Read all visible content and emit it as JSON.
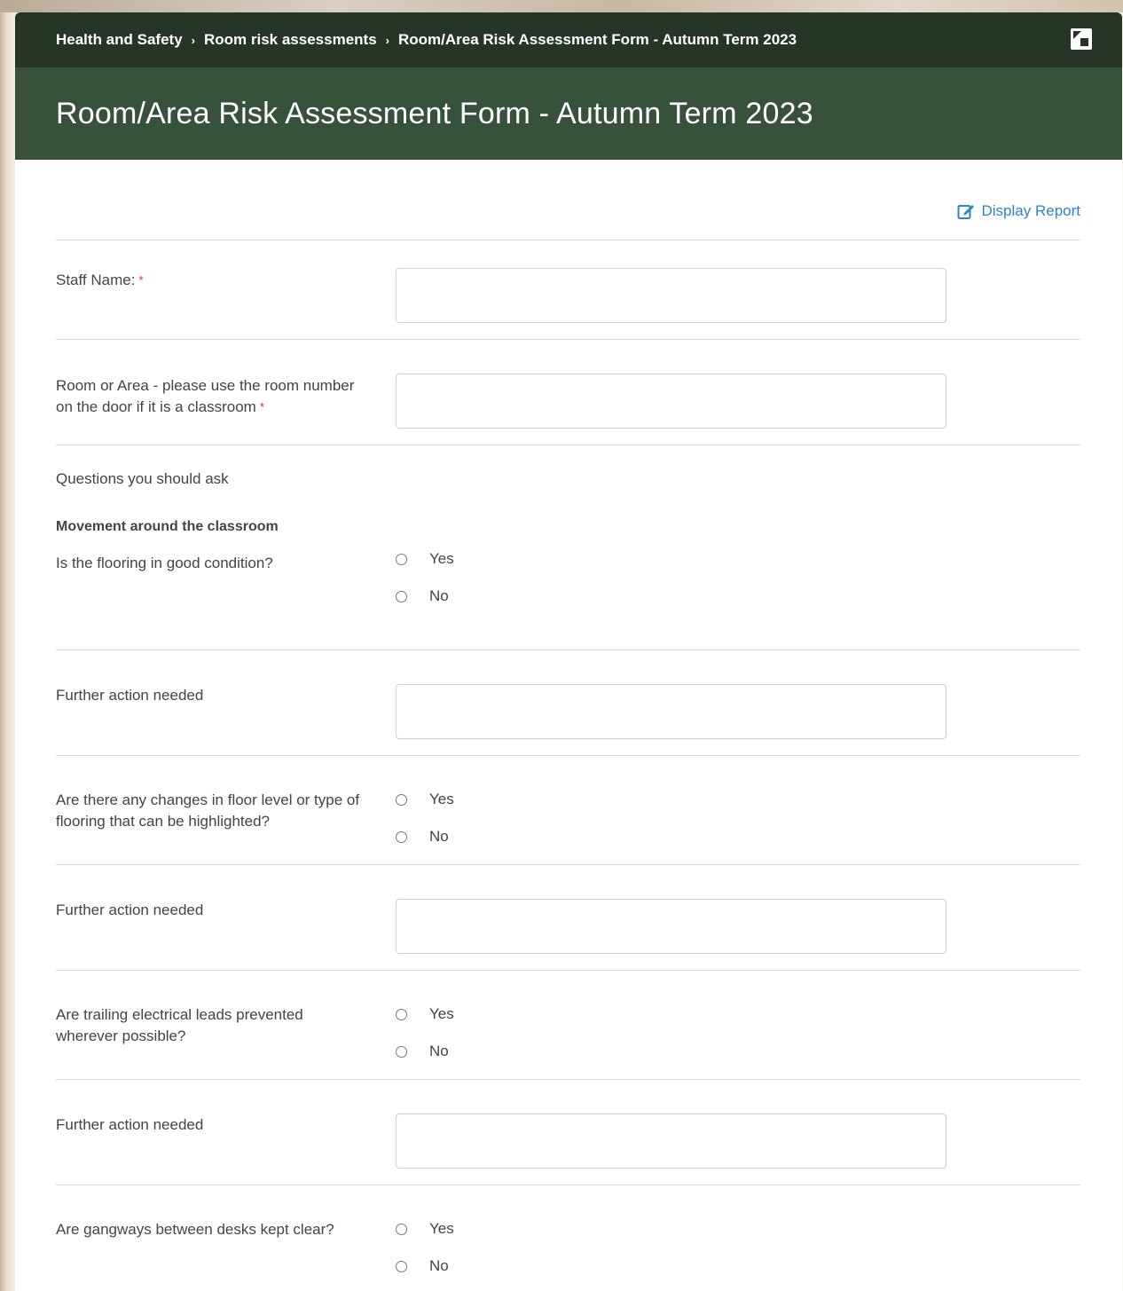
{
  "breadcrumb": {
    "items": [
      "Health and Safety",
      "Room risk assessments",
      "Room/Area Risk Assessment Form - Autumn Term 2023"
    ],
    "separator": "›"
  },
  "page": {
    "title": "Room/Area Risk Assessment Form - Autumn Term 2023",
    "display_report": "Display Report"
  },
  "colors": {
    "header_dark": "#263527",
    "header_green": "#37513a",
    "link": "#2a86c9",
    "required": "#d32f2f"
  },
  "form": {
    "staff_name": {
      "label": "Staff Name:",
      "required_mark": "*",
      "value": ""
    },
    "room": {
      "label": "Room or Area - please use the room number on the door if it is a classroom",
      "required_mark": "*",
      "value": ""
    },
    "intro": "Questions you should ask",
    "section": "Movement around the classroom",
    "questions": [
      {
        "label": "Is the flooring in good condition?",
        "options": [
          "Yes",
          "No"
        ],
        "action_label": "Further action needed",
        "action_value": ""
      },
      {
        "label": "Are there any changes in floor level or type of flooring that can be highlighted?",
        "options": [
          "Yes",
          "No"
        ],
        "action_label": "Further action needed",
        "action_value": ""
      },
      {
        "label": "Are trailing electrical leads prevented wherever possible?",
        "options": [
          "Yes",
          "No"
        ],
        "action_label": "Further action needed",
        "action_value": ""
      },
      {
        "label": "Are gangways between desks kept clear?",
        "options": [
          "Yes",
          "No"
        ]
      }
    ]
  }
}
